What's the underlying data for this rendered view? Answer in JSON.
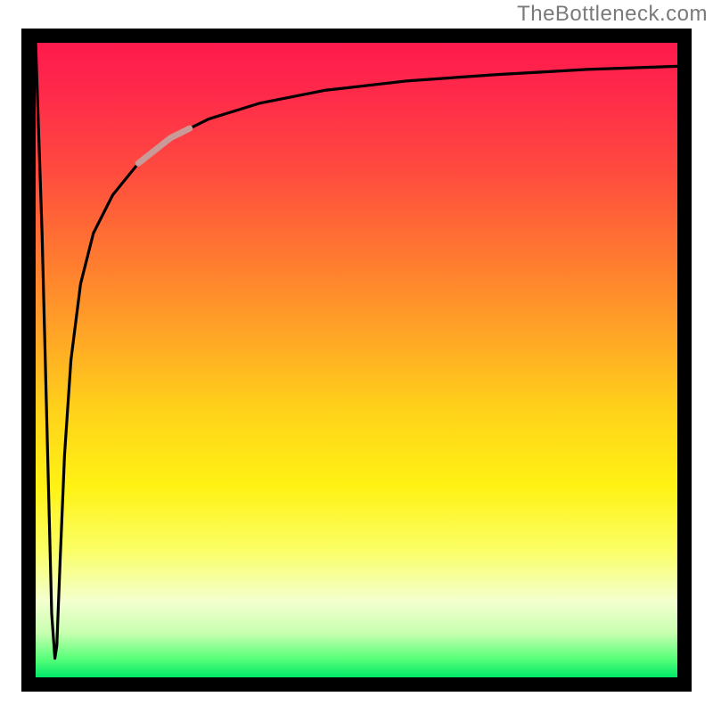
{
  "watermark": {
    "text": "TheBottleneck.com"
  },
  "chart_data": {
    "type": "line",
    "title": "",
    "xlabel": "",
    "ylabel": "",
    "xlim": [
      0,
      100
    ],
    "ylim": [
      0,
      100
    ],
    "grid": false,
    "legend": false,
    "background": {
      "type": "vertical-gradient",
      "stops": [
        {
          "pos": 0.0,
          "color": "#ff1a4d"
        },
        {
          "pos": 0.5,
          "color": "#ffd21a"
        },
        {
          "pos": 0.9,
          "color": "#f3ffcf"
        },
        {
          "pos": 1.0,
          "color": "#00e868"
        }
      ]
    },
    "series": [
      {
        "name": "bottleneck-curve",
        "color": "#000000",
        "x": [
          0.0,
          1.0,
          2.0,
          2.5,
          3.0,
          3.3,
          3.8,
          4.5,
          5.5,
          7.0,
          9.0,
          12.0,
          16.0,
          21.0,
          27.0,
          35.0,
          45.0,
          58.0,
          72.0,
          86.0,
          100.0
        ],
        "y": [
          100.0,
          70.0,
          30.0,
          10.0,
          3.0,
          5.0,
          18.0,
          35.0,
          50.0,
          62.0,
          70.0,
          76.0,
          81.0,
          85.0,
          88.0,
          90.5,
          92.5,
          94.0,
          95.0,
          95.8,
          96.3
        ]
      }
    ],
    "highlight_segment": {
      "series": "bottleneck-curve",
      "x_range": [
        16.0,
        24.0
      ],
      "color": "#c99a97",
      "width": 7
    }
  }
}
